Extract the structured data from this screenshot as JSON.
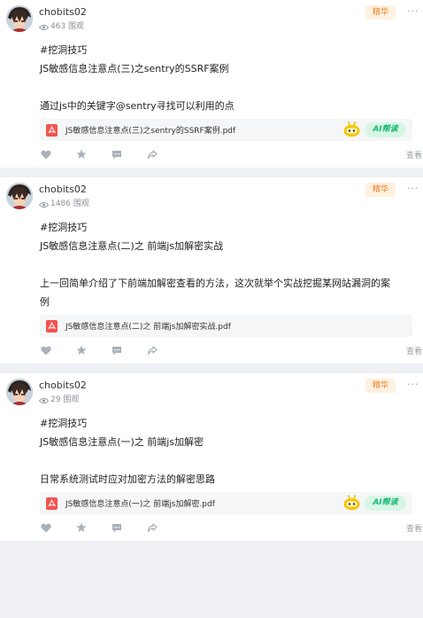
{
  "colors": {
    "badge_bg": "#fff1e0",
    "badge_text": "#ef7c1d",
    "ai_bg": "#d7f6e6",
    "ai_text": "#19b873",
    "pdf": "#f3544e"
  },
  "posts": [
    {
      "author": "chobits02",
      "views": "463 围观",
      "badge": "精华",
      "more": "···",
      "lines": [
        "#挖洞技巧",
        "JS敏感信息注意点(三)之sentry的SSRF案例",
        "",
        "通过js中的关键字@sentry寻找可以利用的点"
      ],
      "attachment": {
        "filename": "JS敏感信息注意点(三)之sentry的SSRF案例.pdf",
        "ai_label": "AI帮读",
        "has_ai": true
      },
      "detail": "查看详情 ›"
    },
    {
      "author": "chobits02",
      "views": "1486 围观",
      "badge": "精华",
      "more": "···",
      "lines": [
        "#挖洞技巧",
        "JS敏感信息注意点(二)之 前端js加解密实战",
        "",
        "上一回简单介绍了下前端加解密查看的方法，这次就举个实战挖掘某网站漏洞的案",
        "例"
      ],
      "attachment": {
        "filename": "JS敏感信息注意点(二)之 前端js加解密实战.pdf",
        "ai_label": "",
        "has_ai": false
      },
      "detail": "查看详情 ›"
    },
    {
      "author": "chobits02",
      "views": "29 围观",
      "badge": "精华",
      "more": "···",
      "lines": [
        "#挖洞技巧",
        "JS敏感信息注意点(一)之 前端js加解密",
        "",
        "日常系统测试时应对加密方法的解密思路"
      ],
      "attachment": {
        "filename": "JS敏感信息注意点(一)之 前端js加解密.pdf",
        "ai_label": "AI帮读",
        "has_ai": true
      },
      "detail": "查看详情 ›"
    }
  ]
}
